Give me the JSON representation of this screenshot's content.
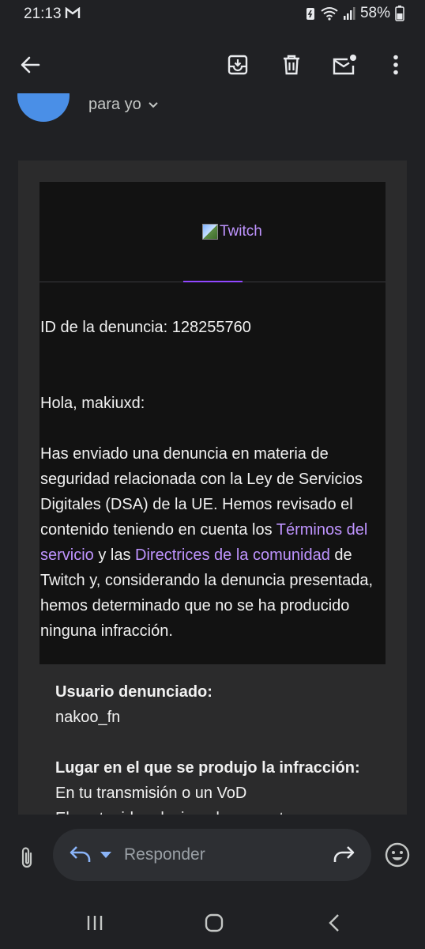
{
  "status": {
    "time": "21:13",
    "battery": "58%"
  },
  "header": {
    "to_label": "para yo"
  },
  "email": {
    "logo_alt": "Twitch",
    "report_id": "ID de la denuncia: 128255760",
    "greeting": "Hola, makiuxd:",
    "p1_a": "Has enviado una denuncia en materia de seguridad relacionada con la Ley de Servicios Digitales (DSA) de la UE. Hemos revisado el contenido teniendo en cuenta los ",
    "link_terms": "Términos del servicio",
    "p1_b": " y las ",
    "link_guidelines": "Directrices de la comunidad",
    "p1_c": " de Twitch y, considerando la denuncia presentada, hemos determinado que no se ha producido ninguna infracción.",
    "reported_user_label": "Usuario denunciado:",
    "reported_user_value": "nakoo_fn",
    "location_label": "Lugar en el que se produjo la infracción:",
    "location_value": "En tu transmisión o un VoD",
    "location_value_2": "El contenido relacionado con esto"
  },
  "reply": {
    "placeholder": "Responder"
  },
  "colors": {
    "accent": "#9147ff",
    "link": "#bf94ff",
    "avatar": "#4a8fe7"
  }
}
